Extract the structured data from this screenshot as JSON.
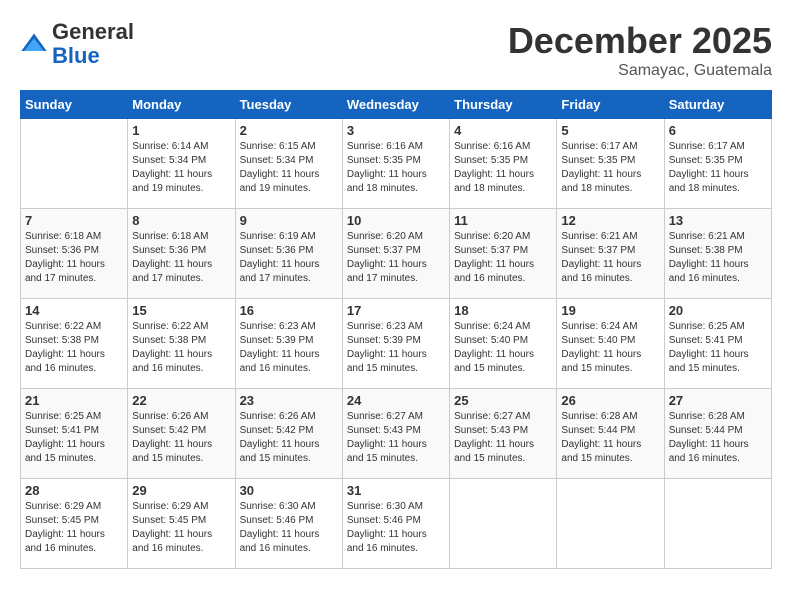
{
  "header": {
    "logo_general": "General",
    "logo_blue": "Blue",
    "month_title": "December 2025",
    "location": "Samayac, Guatemala"
  },
  "days_of_week": [
    "Sunday",
    "Monday",
    "Tuesday",
    "Wednesday",
    "Thursday",
    "Friday",
    "Saturday"
  ],
  "weeks": [
    [
      {
        "num": "",
        "sunrise": "",
        "sunset": "",
        "daylight": ""
      },
      {
        "num": "1",
        "sunrise": "Sunrise: 6:14 AM",
        "sunset": "Sunset: 5:34 PM",
        "daylight": "Daylight: 11 hours and 19 minutes."
      },
      {
        "num": "2",
        "sunrise": "Sunrise: 6:15 AM",
        "sunset": "Sunset: 5:34 PM",
        "daylight": "Daylight: 11 hours and 19 minutes."
      },
      {
        "num": "3",
        "sunrise": "Sunrise: 6:16 AM",
        "sunset": "Sunset: 5:35 PM",
        "daylight": "Daylight: 11 hours and 18 minutes."
      },
      {
        "num": "4",
        "sunrise": "Sunrise: 6:16 AM",
        "sunset": "Sunset: 5:35 PM",
        "daylight": "Daylight: 11 hours and 18 minutes."
      },
      {
        "num": "5",
        "sunrise": "Sunrise: 6:17 AM",
        "sunset": "Sunset: 5:35 PM",
        "daylight": "Daylight: 11 hours and 18 minutes."
      },
      {
        "num": "6",
        "sunrise": "Sunrise: 6:17 AM",
        "sunset": "Sunset: 5:35 PM",
        "daylight": "Daylight: 11 hours and 18 minutes."
      }
    ],
    [
      {
        "num": "7",
        "sunrise": "Sunrise: 6:18 AM",
        "sunset": "Sunset: 5:36 PM",
        "daylight": "Daylight: 11 hours and 17 minutes."
      },
      {
        "num": "8",
        "sunrise": "Sunrise: 6:18 AM",
        "sunset": "Sunset: 5:36 PM",
        "daylight": "Daylight: 11 hours and 17 minutes."
      },
      {
        "num": "9",
        "sunrise": "Sunrise: 6:19 AM",
        "sunset": "Sunset: 5:36 PM",
        "daylight": "Daylight: 11 hours and 17 minutes."
      },
      {
        "num": "10",
        "sunrise": "Sunrise: 6:20 AM",
        "sunset": "Sunset: 5:37 PM",
        "daylight": "Daylight: 11 hours and 17 minutes."
      },
      {
        "num": "11",
        "sunrise": "Sunrise: 6:20 AM",
        "sunset": "Sunset: 5:37 PM",
        "daylight": "Daylight: 11 hours and 16 minutes."
      },
      {
        "num": "12",
        "sunrise": "Sunrise: 6:21 AM",
        "sunset": "Sunset: 5:37 PM",
        "daylight": "Daylight: 11 hours and 16 minutes."
      },
      {
        "num": "13",
        "sunrise": "Sunrise: 6:21 AM",
        "sunset": "Sunset: 5:38 PM",
        "daylight": "Daylight: 11 hours and 16 minutes."
      }
    ],
    [
      {
        "num": "14",
        "sunrise": "Sunrise: 6:22 AM",
        "sunset": "Sunset: 5:38 PM",
        "daylight": "Daylight: 11 hours and 16 minutes."
      },
      {
        "num": "15",
        "sunrise": "Sunrise: 6:22 AM",
        "sunset": "Sunset: 5:38 PM",
        "daylight": "Daylight: 11 hours and 16 minutes."
      },
      {
        "num": "16",
        "sunrise": "Sunrise: 6:23 AM",
        "sunset": "Sunset: 5:39 PM",
        "daylight": "Daylight: 11 hours and 16 minutes."
      },
      {
        "num": "17",
        "sunrise": "Sunrise: 6:23 AM",
        "sunset": "Sunset: 5:39 PM",
        "daylight": "Daylight: 11 hours and 15 minutes."
      },
      {
        "num": "18",
        "sunrise": "Sunrise: 6:24 AM",
        "sunset": "Sunset: 5:40 PM",
        "daylight": "Daylight: 11 hours and 15 minutes."
      },
      {
        "num": "19",
        "sunrise": "Sunrise: 6:24 AM",
        "sunset": "Sunset: 5:40 PM",
        "daylight": "Daylight: 11 hours and 15 minutes."
      },
      {
        "num": "20",
        "sunrise": "Sunrise: 6:25 AM",
        "sunset": "Sunset: 5:41 PM",
        "daylight": "Daylight: 11 hours and 15 minutes."
      }
    ],
    [
      {
        "num": "21",
        "sunrise": "Sunrise: 6:25 AM",
        "sunset": "Sunset: 5:41 PM",
        "daylight": "Daylight: 11 hours and 15 minutes."
      },
      {
        "num": "22",
        "sunrise": "Sunrise: 6:26 AM",
        "sunset": "Sunset: 5:42 PM",
        "daylight": "Daylight: 11 hours and 15 minutes."
      },
      {
        "num": "23",
        "sunrise": "Sunrise: 6:26 AM",
        "sunset": "Sunset: 5:42 PM",
        "daylight": "Daylight: 11 hours and 15 minutes."
      },
      {
        "num": "24",
        "sunrise": "Sunrise: 6:27 AM",
        "sunset": "Sunset: 5:43 PM",
        "daylight": "Daylight: 11 hours and 15 minutes."
      },
      {
        "num": "25",
        "sunrise": "Sunrise: 6:27 AM",
        "sunset": "Sunset: 5:43 PM",
        "daylight": "Daylight: 11 hours and 15 minutes."
      },
      {
        "num": "26",
        "sunrise": "Sunrise: 6:28 AM",
        "sunset": "Sunset: 5:44 PM",
        "daylight": "Daylight: 11 hours and 15 minutes."
      },
      {
        "num": "27",
        "sunrise": "Sunrise: 6:28 AM",
        "sunset": "Sunset: 5:44 PM",
        "daylight": "Daylight: 11 hours and 16 minutes."
      }
    ],
    [
      {
        "num": "28",
        "sunrise": "Sunrise: 6:29 AM",
        "sunset": "Sunset: 5:45 PM",
        "daylight": "Daylight: 11 hours and 16 minutes."
      },
      {
        "num": "29",
        "sunrise": "Sunrise: 6:29 AM",
        "sunset": "Sunset: 5:45 PM",
        "daylight": "Daylight: 11 hours and 16 minutes."
      },
      {
        "num": "30",
        "sunrise": "Sunrise: 6:30 AM",
        "sunset": "Sunset: 5:46 PM",
        "daylight": "Daylight: 11 hours and 16 minutes."
      },
      {
        "num": "31",
        "sunrise": "Sunrise: 6:30 AM",
        "sunset": "Sunset: 5:46 PM",
        "daylight": "Daylight: 11 hours and 16 minutes."
      },
      {
        "num": "",
        "sunrise": "",
        "sunset": "",
        "daylight": ""
      },
      {
        "num": "",
        "sunrise": "",
        "sunset": "",
        "daylight": ""
      },
      {
        "num": "",
        "sunrise": "",
        "sunset": "",
        "daylight": ""
      }
    ]
  ]
}
